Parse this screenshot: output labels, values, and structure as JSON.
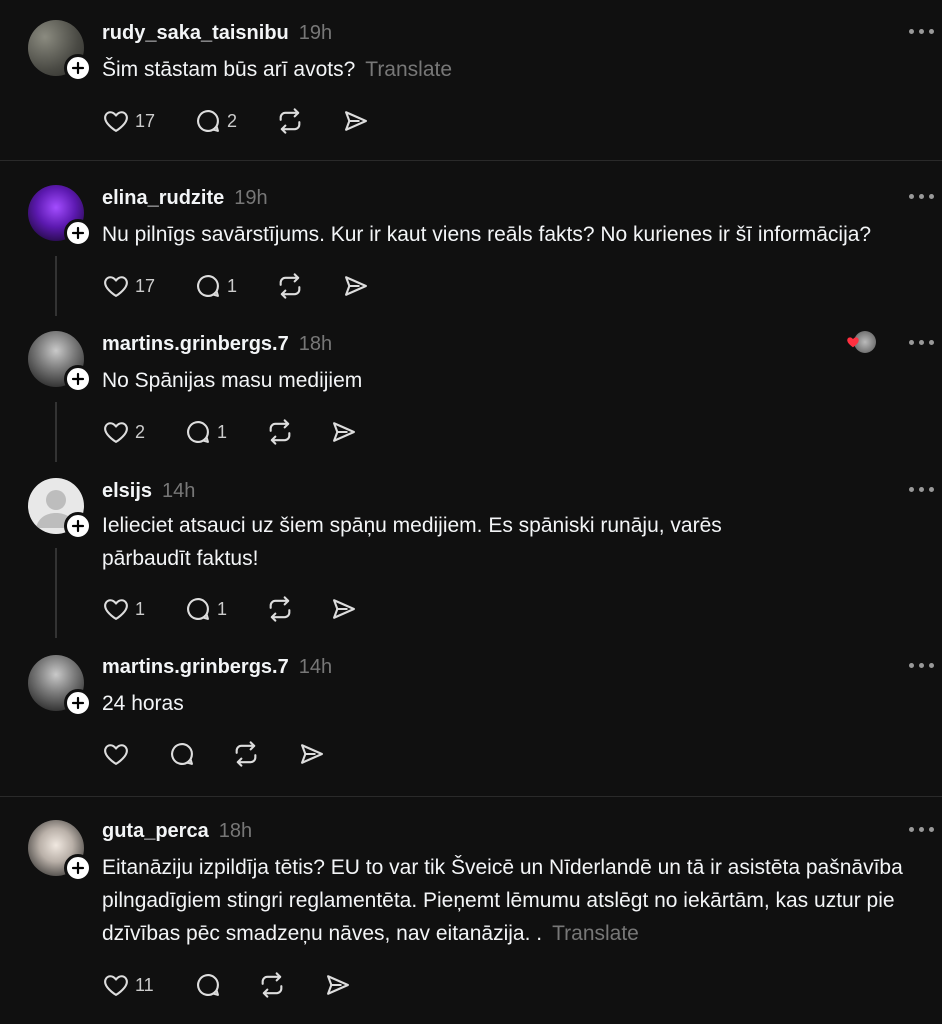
{
  "translate_label": "Translate",
  "posts": [
    {
      "username": "rudy_saka_taisnibu",
      "time": "19h",
      "text": "Šim stāstam būs arī avots?",
      "likes": "17",
      "replies": "2"
    },
    {
      "username": "elina_rudzite",
      "time": "19h",
      "text": "Nu pilnīgs savārstījums. Kur ir kaut viens reāls fakts? No kurienes ir šī informācija?",
      "likes": "17",
      "replies": "1"
    },
    {
      "username": "martins.grinbergs.7",
      "time": "18h",
      "text": "No Spānijas masu medijiem",
      "likes": "2",
      "replies": "1"
    },
    {
      "username": "elsijs",
      "time": "14h",
      "text": "Ielieciet atsauci uz šiem spāņu medijiem. Es spāniski runāju, varēs pārbaudīt faktus!",
      "likes": "1",
      "replies": "1"
    },
    {
      "username": "martins.grinbergs.7",
      "time": "14h",
      "text": "24 horas",
      "likes": "",
      "replies": ""
    },
    {
      "username": "guta_perca",
      "time": "18h",
      "text": "Eitanāziju izpildīja tētis? EU to var tik Šveicē un Nīderlandē un tā ir asistēta pašnāvība pilngadīgiem stingri reglamentēta. Pieņemt lēmumu atslēgt no iekārtām, kas uztur pie dzīvības pēc smadzeņu nāves, nav eitanāzija. .",
      "likes": "11",
      "replies": ""
    }
  ]
}
